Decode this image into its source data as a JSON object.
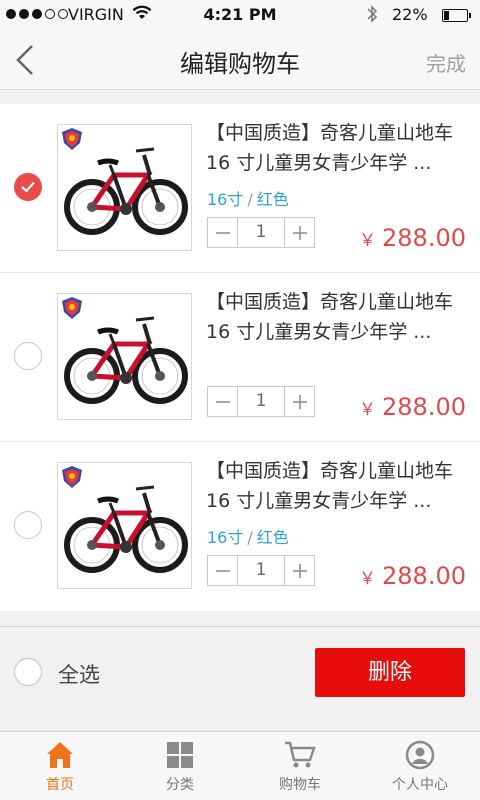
{
  "status_bar": {
    "carrier": "VIRGIN",
    "time": "4:21 PM",
    "battery_text": "22%",
    "battery_level": 0.22
  },
  "nav": {
    "title": "编辑购物车",
    "done_label": "完成"
  },
  "items": [
    {
      "title": "【中国质造】奇客儿童山地车 16 寸儿童男女青少年学 ...",
      "spec_size": "16寸",
      "spec_sep": "/",
      "spec_color": "红色",
      "quantity": "1",
      "currency": "￥",
      "price": "288.00",
      "selected": true
    },
    {
      "title": "【中国质造】奇客儿童山地车 16 寸儿童男女青少年学 ...",
      "spec_size": "",
      "spec_sep": "",
      "spec_color": "",
      "quantity": "1",
      "currency": "￥",
      "price": "288.00",
      "selected": false
    },
    {
      "title": "【中国质造】奇客儿童山地车 16 寸儿童男女青少年学 ...",
      "spec_size": "16寸",
      "spec_sep": "/",
      "spec_color": "红色",
      "quantity": "1",
      "currency": "￥",
      "price": "288.00",
      "selected": false
    }
  ],
  "actions": {
    "select_all_label": "全选",
    "delete_label": "删除"
  },
  "tabs": [
    {
      "label": "首页",
      "icon": "home-icon",
      "active": true
    },
    {
      "label": "分类",
      "icon": "category-icon",
      "active": false
    },
    {
      "label": "购物车",
      "icon": "cart-icon",
      "active": false
    },
    {
      "label": "个人中心",
      "icon": "profile-icon",
      "active": false
    }
  ],
  "colors": {
    "accent_red": "#e80d0d",
    "price_red": "#e14a4a",
    "spec_blue": "#2ba2dc",
    "tab_active_orange": "#f0731a"
  }
}
